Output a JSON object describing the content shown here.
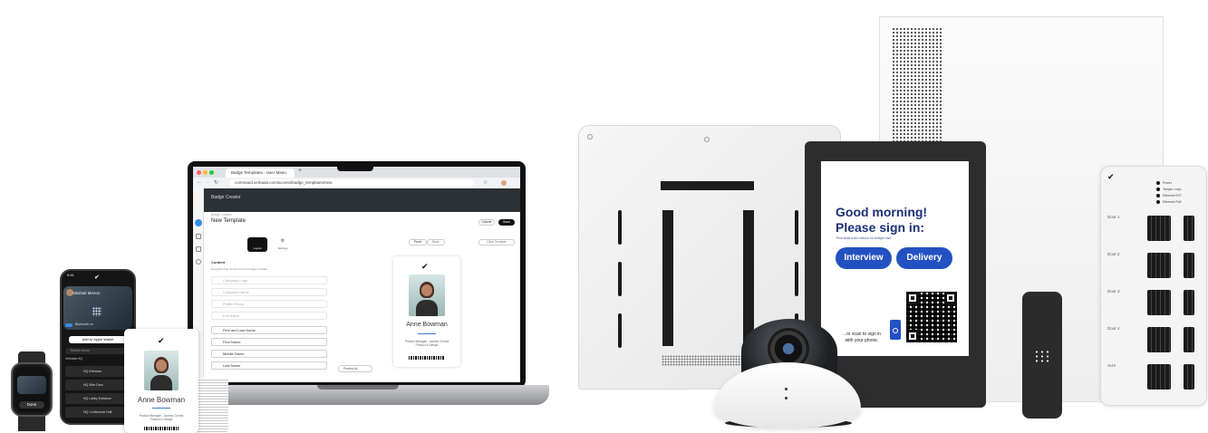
{
  "laptop": {
    "browser_tab_title": "Badge Templates - User Manu",
    "url": "command.verkada.com/access/badge_templates/new",
    "breadcrumb": "Badge Creator",
    "page_title": "New Template",
    "cancel_label": "Cancel",
    "save_label": "Save",
    "tabs": [
      "Layout",
      "Settings"
    ],
    "side_toggle": [
      "Front",
      "Back"
    ],
    "clear_label": "Clear Template",
    "section_title": "Content",
    "section_hint": "Drag and drop content into the badge template",
    "content_items": [
      "Company Logo",
      "Company Name",
      "Profile Photo",
      "Full Name",
      "First and Last Name",
      "First Name",
      "Middle Name",
      "Last Name"
    ],
    "preview_name": "Anne Bowman",
    "preview_role": "Product Manager - Access Control",
    "preview_role_line2": "Product & Design",
    "preview_label": "Preview As"
  },
  "phone": {
    "time": "9:41",
    "user_name": "Vaishali Menon",
    "bluetooth_label": "Bluetooth on",
    "wallet_button": "Add to Apple Wallet",
    "search_placeholder": "Search doors",
    "group_label": "Verkada HQ",
    "doors": [
      "HQ Entrance",
      "HQ Side Door",
      "HQ Lobby Entrance",
      "HQ Conference Hall"
    ]
  },
  "watch": {
    "done_label": "Done"
  },
  "badge_card": {
    "name": "Anne Bowman",
    "role_line1": "Product Manager - Access Control",
    "role_line2": "Product & Design"
  },
  "tablet": {
    "greeting_line1": "Good morning!",
    "greeting_line2": "Please sign in:",
    "purpose_prompt": "Pick what is the reason for today's visit",
    "option_interview": "Interview",
    "option_delivery": "Delivery",
    "scan_line1": "...or scan to sign in",
    "scan_line2": "with your phone."
  },
  "controller": {
    "leds": [
      "Power",
      "Tamper Loop",
      "Ethernet EXT",
      "Ethernet PoE"
    ],
    "doors": [
      "Door 1",
      "Door 2",
      "Door 3",
      "Door 4",
      "AUX"
    ]
  },
  "colors": {
    "tablet_button": "#2351c2",
    "tablet_heading": "#1c2f75",
    "device_dark": "#1a1a1a",
    "device_white": "#f4f4f4"
  }
}
